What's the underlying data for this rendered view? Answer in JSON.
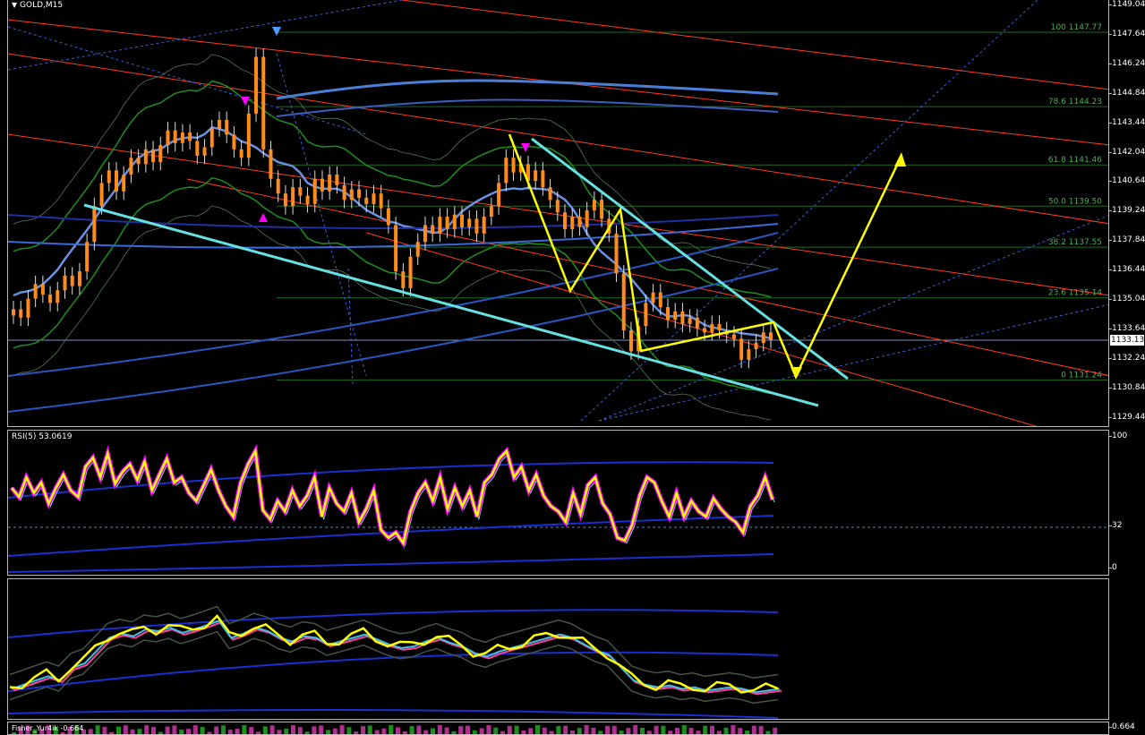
{
  "window": {
    "symbol_label": "GOLD,M15",
    "menu_icon": "triangle-down-icon"
  },
  "colors": {
    "candle": "#ff8c1a",
    "wick": "#ffffff",
    "channel": "#ff3b1f",
    "bands": "#4a7fd8",
    "green_band": "#1e8f1e",
    "fib": "#1f6b1f",
    "yellow": "#ffff00",
    "cyan": "#66e0e0",
    "magenta": "#ff00ff"
  },
  "main_axis": {
    "ticks": [
      "1149.04",
      "1147.64",
      "1146.24",
      "1144.84",
      "1143.44",
      "1142.04",
      "1140.64",
      "1139.24",
      "1137.84",
      "1136.44",
      "1135.04",
      "1133.64",
      "1132.24",
      "1130.84",
      "1129.44"
    ],
    "current_price": "1133.13"
  },
  "fib_levels": [
    {
      "label": "100 1147.77",
      "value": 1147.77
    },
    {
      "label": "78.6 1144.23",
      "value": 1144.23
    },
    {
      "label": "61.8 1141.46",
      "value": 1141.46
    },
    {
      "label": "50.0 1139.50",
      "value": 1139.5
    },
    {
      "label": "38.2 1137.55",
      "value": 1137.55
    },
    {
      "label": "23.6 1135.14",
      "value": 1135.14
    },
    {
      "label": "0 1131.24",
      "value": 1131.24
    }
  ],
  "rsi_panel": {
    "title": "RSI(5) 53.0619",
    "ticks": [
      "100",
      "32",
      "0"
    ]
  },
  "fisher_panel": {
    "title": "Fisher_Yur4ik -0.664",
    "right_label": "0.664"
  },
  "chart_data": {
    "type": "line",
    "title": "GOLD,M15",
    "ylim": [
      1129.0,
      1149.3
    ],
    "current_price": 1133.13,
    "candle_closes": [
      1134.6,
      1134.2,
      1135.1,
      1135.8,
      1135.3,
      1134.9,
      1135.5,
      1136.2,
      1135.7,
      1136.4,
      1137.8,
      1139.5,
      1140.6,
      1141.2,
      1140.2,
      1141.0,
      1141.8,
      1141.5,
      1142.2,
      1141.6,
      1142.4,
      1143.1,
      1142.5,
      1143.0,
      1142.6,
      1141.9,
      1142.3,
      1143.2,
      1143.6,
      1142.9,
      1142.2,
      1141.8,
      1143.9,
      1146.6,
      1142.2,
      1140.8,
      1140.1,
      1139.5,
      1140.4,
      1140.0,
      1139.6,
      1140.8,
      1140.2,
      1141.0,
      1140.5,
      1139.8,
      1140.3,
      1139.9,
      1139.6,
      1140.1,
      1139.4,
      1138.6,
      1136.4,
      1135.6,
      1137.1,
      1137.8,
      1138.6,
      1138.2,
      1139.0,
      1138.4,
      1139.1,
      1138.5,
      1138.9,
      1138.2,
      1139.0,
      1139.5,
      1140.6,
      1141.8,
      1141.1,
      1141.5,
      1140.7,
      1141.2,
      1140.4,
      1139.8,
      1139.2,
      1138.4,
      1139.0,
      1138.5,
      1139.3,
      1139.8,
      1138.9,
      1138.2,
      1136.3,
      1133.6,
      1132.6,
      1133.8,
      1134.9,
      1135.4,
      1134.7,
      1134.1,
      1134.5,
      1133.9,
      1134.2,
      1133.7,
      1133.5,
      1133.9,
      1133.6,
      1133.4,
      1133.2,
      1132.2,
      1132.7,
      1133.0,
      1133.5,
      1133.13
    ],
    "fib_retracement": [
      1147.77,
      1144.23,
      1141.46,
      1139.5,
      1137.55,
      1135.14,
      1131.24
    ],
    "rsi": {
      "name": "RSI(5)",
      "last": 53.0619,
      "levels": [
        100,
        32,
        0
      ],
      "values": [
        62,
        55,
        70,
        58,
        66,
        50,
        62,
        72,
        60,
        55,
        78,
        85,
        70,
        88,
        65,
        74,
        80,
        68,
        82,
        60,
        72,
        84,
        66,
        70,
        58,
        52,
        64,
        76,
        60,
        48,
        40,
        66,
        80,
        90,
        45,
        38,
        52,
        44,
        60,
        48,
        56,
        70,
        40,
        62,
        50,
        44,
        58,
        36,
        46,
        60,
        30,
        24,
        28,
        20,
        44,
        58,
        66,
        52,
        70,
        46,
        62,
        48,
        60,
        40,
        66,
        72,
        84,
        90,
        70,
        78,
        60,
        72,
        56,
        48,
        44,
        36,
        58,
        42,
        64,
        70,
        50,
        42,
        24,
        22,
        34,
        56,
        70,
        66,
        52,
        40,
        58,
        40,
        52,
        44,
        40,
        54,
        46,
        40,
        36,
        28,
        48,
        56,
        70,
        53
      ]
    },
    "osc": {
      "values": [
        0.1,
        0.15,
        0.2,
        0.25,
        0.2,
        0.35,
        0.4,
        0.55,
        0.7,
        0.75,
        0.72,
        0.8,
        0.78,
        0.82,
        0.76,
        0.8,
        0.85,
        0.9,
        0.7,
        0.75,
        0.82,
        0.78,
        0.7,
        0.66,
        0.72,
        0.7,
        0.62,
        0.66,
        0.7,
        0.74,
        0.68,
        0.62,
        0.58,
        0.6,
        0.66,
        0.7,
        0.64,
        0.6,
        0.52,
        0.48,
        0.54,
        0.58,
        0.62,
        0.66,
        0.7,
        0.74,
        0.7,
        0.62,
        0.55,
        0.5,
        0.35,
        0.2,
        0.15,
        0.12,
        0.14,
        0.1,
        0.12,
        0.08,
        0.1,
        0.12,
        0.1,
        0.06,
        0.08,
        0.1
      ]
    }
  }
}
